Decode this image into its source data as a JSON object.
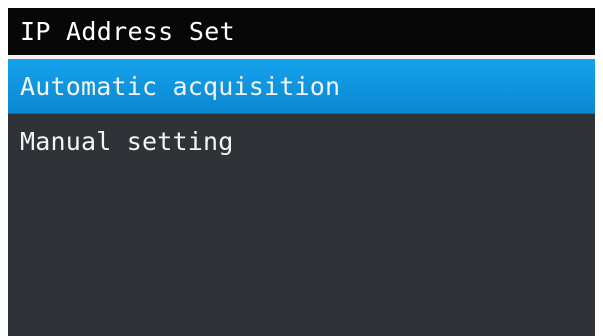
{
  "screen": {
    "title": "IP Address Set",
    "menu": {
      "items": [
        {
          "label": "Automatic acquisition",
          "selected": true
        },
        {
          "label": "Manual setting",
          "selected": false
        }
      ]
    }
  },
  "colors": {
    "title_bar": "#070707",
    "background": "#2f3338",
    "selection_highlight": "#0a87d1",
    "text": "#f4f4f4"
  }
}
